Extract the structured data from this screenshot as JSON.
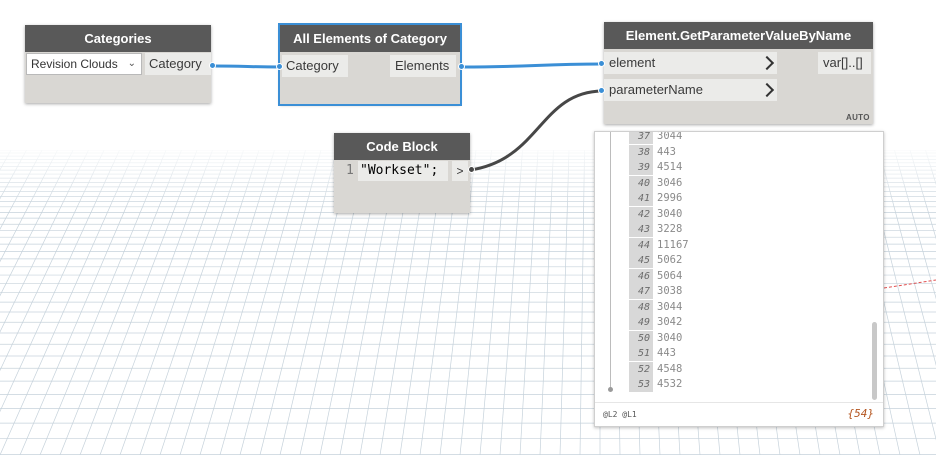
{
  "colors": {
    "header_bg": "#595959",
    "node_body": "#d9d7d3",
    "port_bg": "#ebebe9",
    "wire_blue": "#3b8fd6",
    "wire_dark": "#474747",
    "selected_outline": "#3b8fd6",
    "list_count": "#b4551f",
    "grid_line": "#c6d2db"
  },
  "nodes": {
    "categories": {
      "title": "Categories",
      "dropdown_value": "Revision Clouds",
      "output": "Category"
    },
    "all_elements": {
      "title": "All Elements of Category",
      "input": "Category",
      "output": "Elements"
    },
    "get_param": {
      "title": "Element.GetParameterValueByName",
      "inputs": [
        "element",
        "parameterName"
      ],
      "output": "var[]..[]",
      "lacing": "AUTO"
    },
    "code_block": {
      "title": "Code Block",
      "line_number": "1",
      "code": "\"Workset\";",
      "output": ">"
    }
  },
  "watch": {
    "rows": [
      {
        "index": "37",
        "value": "3044"
      },
      {
        "index": "38",
        "value": "443"
      },
      {
        "index": "39",
        "value": "4514"
      },
      {
        "index": "40",
        "value": "3046"
      },
      {
        "index": "41",
        "value": "2996"
      },
      {
        "index": "42",
        "value": "3040"
      },
      {
        "index": "43",
        "value": "3228"
      },
      {
        "index": "44",
        "value": "11167"
      },
      {
        "index": "45",
        "value": "5062"
      },
      {
        "index": "46",
        "value": "5064"
      },
      {
        "index": "47",
        "value": "3038"
      },
      {
        "index": "48",
        "value": "3044"
      },
      {
        "index": "49",
        "value": "3042"
      },
      {
        "index": "50",
        "value": "3040"
      },
      {
        "index": "51",
        "value": "443"
      },
      {
        "index": "52",
        "value": "4548"
      },
      {
        "index": "53",
        "value": "4532"
      }
    ],
    "levels": "@L2 @L1",
    "count": "{54}"
  }
}
